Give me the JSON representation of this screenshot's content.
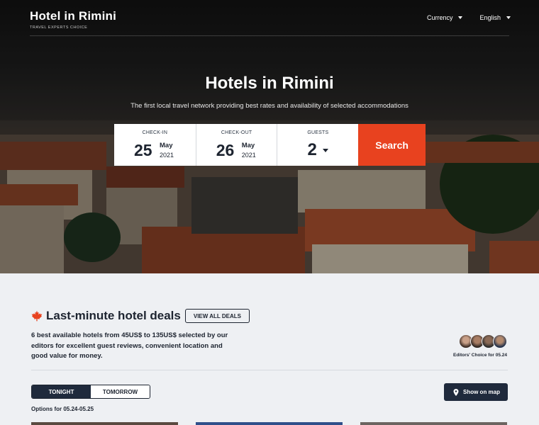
{
  "brand": {
    "title": "Hotel in Rimini",
    "subtitle": "TRAVEL EXPERTS CHOICE"
  },
  "nav": {
    "currency": "Currency",
    "language": "English"
  },
  "hero": {
    "title": "Hotels in Rimini",
    "subtitle": "The first local travel network providing best rates and availability of selected accommodations"
  },
  "search": {
    "checkin": {
      "label": "CHECK-IN",
      "day": "25",
      "month": "May",
      "year": "2021"
    },
    "checkout": {
      "label": "CHECK-OUT",
      "day": "26",
      "month": "May",
      "year": "2021"
    },
    "guests": {
      "label": "GUESTS",
      "value": "2"
    },
    "button": "Search"
  },
  "deals": {
    "title": "Last-minute hotel deals",
    "view_all": "VIEW ALL DEALS",
    "description": "6 best available hotels from 45US$ to 135US$ selected by our editors for excellent guest reviews, convenient location and good value for money.",
    "editors_caption": "Editors' Choice for 05.24",
    "tabs": [
      {
        "label": "TONIGHT",
        "active": true
      },
      {
        "label": "TOMORROW",
        "active": false
      }
    ],
    "options_text": "Options for 05.24-05.25",
    "map_button": "Show on map"
  },
  "colors": {
    "accent": "#e8421f",
    "dark": "#1f2a3c",
    "background": "#eef0f3"
  },
  "icons": {
    "leaf": "maple-leaf-icon",
    "map": "map-pin-icon",
    "dropdown": "caret-down-icon"
  }
}
